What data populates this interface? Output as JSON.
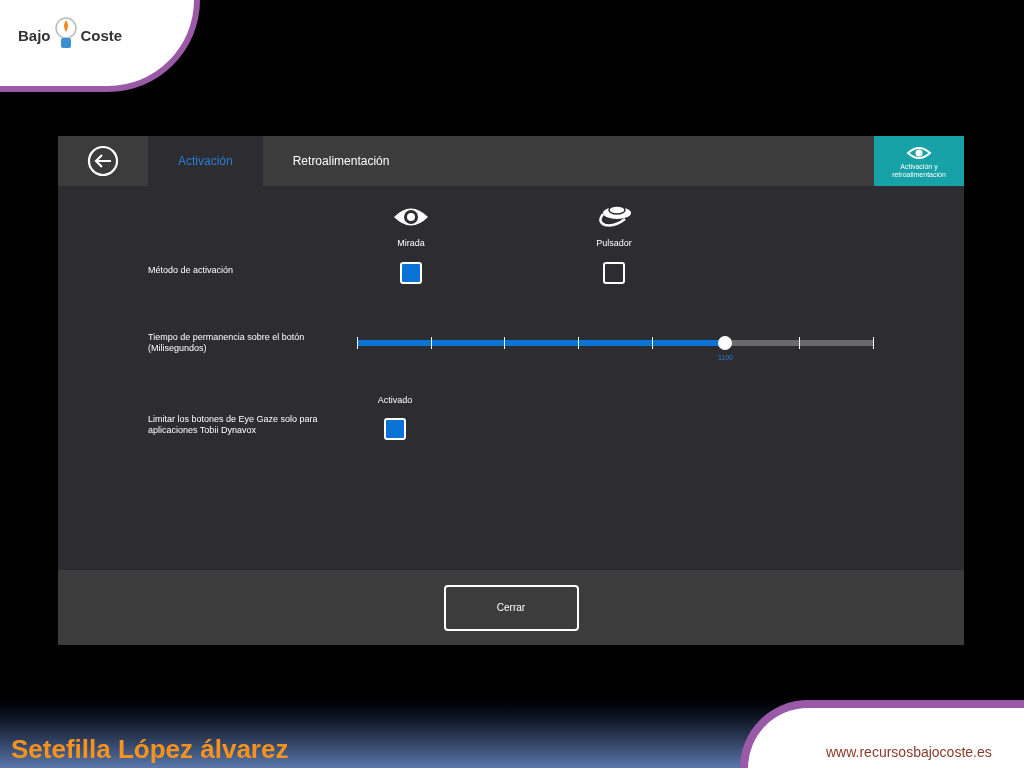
{
  "logo": {
    "left": "Bajo",
    "right": "Coste"
  },
  "window": {
    "tabs": [
      {
        "label": "Activación",
        "selected": true
      },
      {
        "label": "Retroalimentación",
        "selected": false
      }
    ],
    "section_badge": "Activación y retroalimentación"
  },
  "activation_method": {
    "label": "Método de activación",
    "options": [
      {
        "label": "Mirada",
        "kind": "eye",
        "checked": true
      },
      {
        "label": "Pulsador",
        "kind": "switch",
        "checked": false
      }
    ]
  },
  "dwell_time": {
    "label": "Tiempo de permanencia sobre el botón (Milisegundos)",
    "level": 0.714,
    "reading": "1100"
  },
  "limit_buttons": {
    "label": "Limitar los botones de Eye Gaze solo para aplicaciones Tobii Dynavox",
    "option_label": "Activado",
    "checked": true
  },
  "close_button": "Cerrar",
  "footer": {
    "author": "Setefilla López álvarez",
    "website": "www.recursosbajocoste.es"
  }
}
